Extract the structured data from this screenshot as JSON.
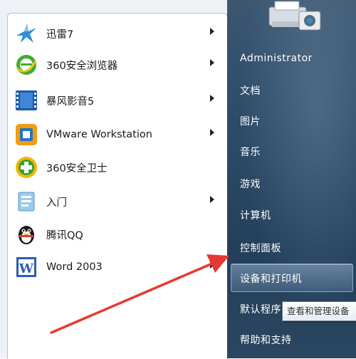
{
  "programs": [
    {
      "label": "迅雷7",
      "icon": "thunder-bird-icon",
      "has_submenu": true
    },
    {
      "label": "360安全浏览器",
      "icon": "browser-360-icon",
      "has_submenu": true
    },
    {
      "label": "暴风影音5",
      "icon": "film-strip-icon",
      "has_submenu": true
    },
    {
      "label": "VMware Workstation",
      "icon": "vmware-icon",
      "has_submenu": true
    },
    {
      "label": "360安全卫士",
      "icon": "security-guard-360-icon",
      "has_submenu": false
    },
    {
      "label": "入门",
      "icon": "getting-started-icon",
      "has_submenu": true
    },
    {
      "label": "腾讯QQ",
      "icon": "qq-penguin-icon",
      "has_submenu": false
    },
    {
      "label": "Word 2003",
      "icon": "word-icon",
      "has_submenu": true
    }
  ],
  "right_menu": {
    "user": "Administrator",
    "documents": "文档",
    "pictures": "图片",
    "music": "音乐",
    "games": "游戏",
    "computer": "计算机",
    "control_panel": "控制面板",
    "devices_printers": "设备和打印机",
    "default_programs": "默认程序",
    "help": "帮助和支持"
  },
  "tooltip": "查看和管理设备",
  "colors": {
    "right_panel": "#2b4864",
    "arrow": "#e53935",
    "highlight_border": "#8aa6c2"
  }
}
